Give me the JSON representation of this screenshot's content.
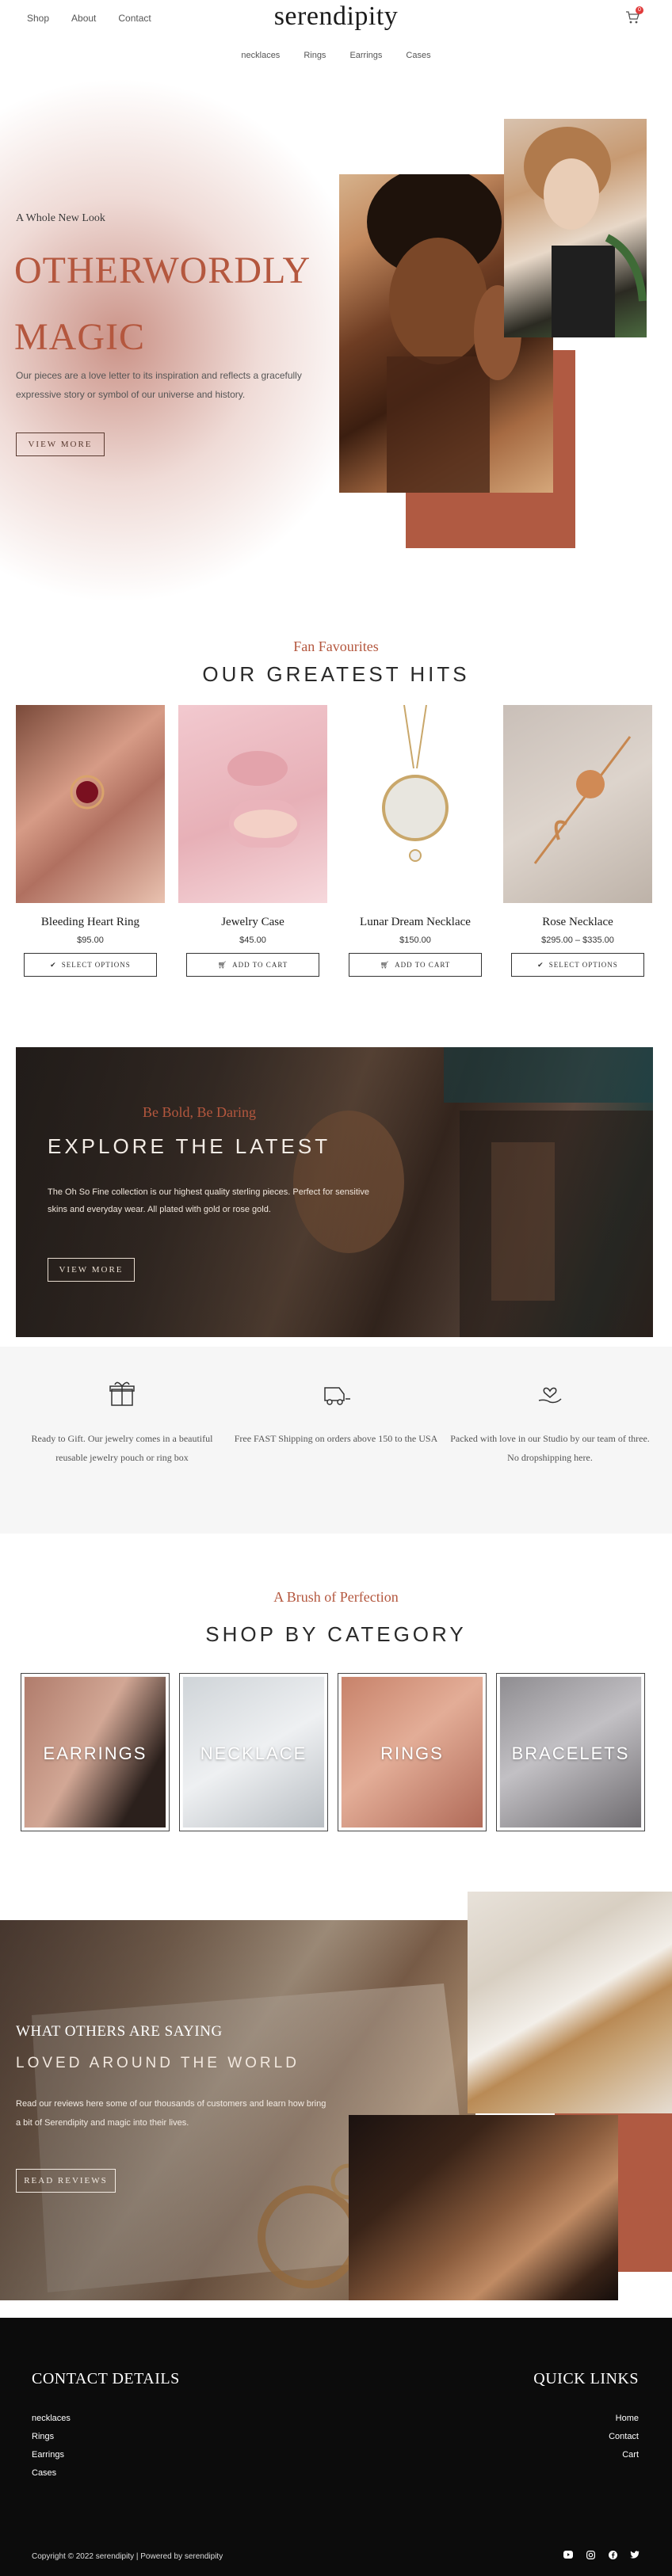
{
  "header": {
    "brand": "serendipity",
    "top_links": [
      "Shop",
      "About",
      "Contact"
    ],
    "cart_count": "0",
    "sub_links": [
      "necklaces",
      "Rings",
      "Earrings",
      "Cases"
    ]
  },
  "hero": {
    "kicker": "A Whole New Look",
    "title_line1": "OTHERWORDLY",
    "title_line2": "MAGIC",
    "description": "Our pieces are a love letter to its inspiration and reflects a gracefully expressive story or symbol of our universe and history.",
    "button": "VIEW MORE"
  },
  "favourites": {
    "kicker": "Fan Favourites",
    "title": "OUR GREATEST HITS",
    "products": [
      {
        "name": "Bleeding Heart Ring",
        "price": "$95.00",
        "cta": "SELECT OPTIONS"
      },
      {
        "name": "Jewelry Case",
        "price": "$45.00",
        "cta": "ADD TO CART"
      },
      {
        "name": "Lunar Dream Necklace",
        "price": "$150.00",
        "cta": "ADD TO CART"
      },
      {
        "name": "Rose Necklace",
        "price": "$295.00 – $335.00",
        "cta": "SELECT OPTIONS"
      }
    ]
  },
  "explore": {
    "kicker": "Be Bold, Be Daring",
    "title": "EXPLORE THE LATEST",
    "description": "The Oh So Fine collection is our highest quality sterling pieces. Perfect for sensitive skins and everyday wear. All plated with gold or rose gold.",
    "button": "VIEW MORE"
  },
  "features": [
    {
      "icon": "gift-box-icon",
      "text": "Ready to Gift. Our jewelry comes in a beautiful reusable jewelry pouch or ring box"
    },
    {
      "icon": "delivery-truck-icon",
      "text": "Free FAST Shipping on orders above 150 to the USA"
    },
    {
      "icon": "heart-hand-icon",
      "text": "Packed with love in our Studio by our team of three. No dropshipping here."
    }
  ],
  "categories": {
    "kicker": "A Brush of Perfection",
    "title": "SHOP BY CATEGORY",
    "items": [
      "EARRINGS",
      "NECKLACE",
      "RINGS",
      "BRACELETS"
    ]
  },
  "testimonials": {
    "kicker": "WHAT OTHERS ARE SAYING",
    "title": "LOVED AROUND THE WORLD",
    "description": "Read our reviews here some of our thousands of customers and learn how bring a bit of Serendipity and magic into their lives.",
    "button": "READ REVIEWS"
  },
  "footer": {
    "contact_title": "CONTACT DETAILS",
    "contact_links": [
      "necklaces",
      "Rings",
      "Earrings",
      "Cases"
    ],
    "quick_title": "QUICK LINKS",
    "quick_links": [
      "Home",
      "Contact",
      "Cart"
    ],
    "copyright": "Copyright © 2022 serendipity | Powered by serendipity",
    "social": [
      "youtube-icon",
      "instagram-icon",
      "facebook-icon",
      "twitter-icon"
    ]
  },
  "colors": {
    "accent": "#b4573e",
    "rust": "#b05a42",
    "footer_bg": "#0c0c0c"
  }
}
